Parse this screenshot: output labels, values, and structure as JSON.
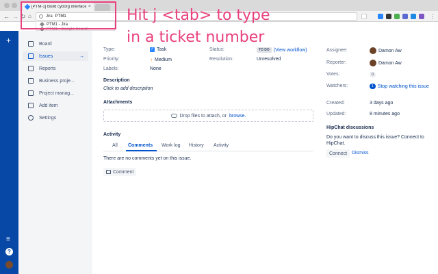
{
  "browser": {
    "active_tab_title": "[PTM-1] Build cyborg interface",
    "omnibox_keyword": "Jira",
    "omnibox_query": "PTM1",
    "suggestions": [
      {
        "label": "PTM1 - Jira"
      },
      {
        "label": "PTM1 - Google Search"
      }
    ]
  },
  "overlay": {
    "line1": "Hit j <tab> to type",
    "line2": "in a ticket number"
  },
  "sidebar": {
    "items": [
      {
        "label": "Board"
      },
      {
        "label": "Issues",
        "arrow": "→"
      },
      {
        "label": "Reports"
      },
      {
        "label": "Business proje..."
      },
      {
        "label": "Project manag..."
      },
      {
        "label": "Add item"
      },
      {
        "label": "Settings"
      }
    ]
  },
  "details": {
    "type_label": "Type:",
    "type_value": "Task",
    "priority_label": "Priority:",
    "priority_value": "Medium",
    "labels_label": "Labels:",
    "labels_value": "None",
    "status_label": "Status:",
    "status_value": "TO DO",
    "workflow_link": "(View workflow)",
    "resolution_label": "Resolution:",
    "resolution_value": "Unresolved"
  },
  "description": {
    "heading": "Description",
    "placeholder": "Click to add description"
  },
  "attachments": {
    "heading": "Attachments",
    "drop_text": "Drop files to attach, or",
    "browse_link": "browse."
  },
  "activity": {
    "heading": "Activity",
    "tabs": [
      "All",
      "Comments",
      "Work log",
      "History",
      "Activity"
    ],
    "active_tab": "Comments",
    "empty_text": "There are no comments yet on this issue.",
    "comment_button": "Comment"
  },
  "people": {
    "assignee_label": "Assignee:",
    "assignee": "Damon Aw",
    "reporter_label": "Reporter:",
    "reporter": "Damon Aw",
    "votes_label": "Votes:",
    "votes": "0",
    "watchers_label": "Watchers:",
    "watchers": "1",
    "watch_link": "Stop watching this issue"
  },
  "dates": {
    "created_label": "Created:",
    "created": "3 days ago",
    "updated_label": "Updated:",
    "updated": "8 minutes ago"
  },
  "hipchat": {
    "heading": "HipChat discussions",
    "text": "Do you want to discuss this issue? Connect to HipChat.",
    "connect": "Connect",
    "dismiss": "Dismiss"
  }
}
